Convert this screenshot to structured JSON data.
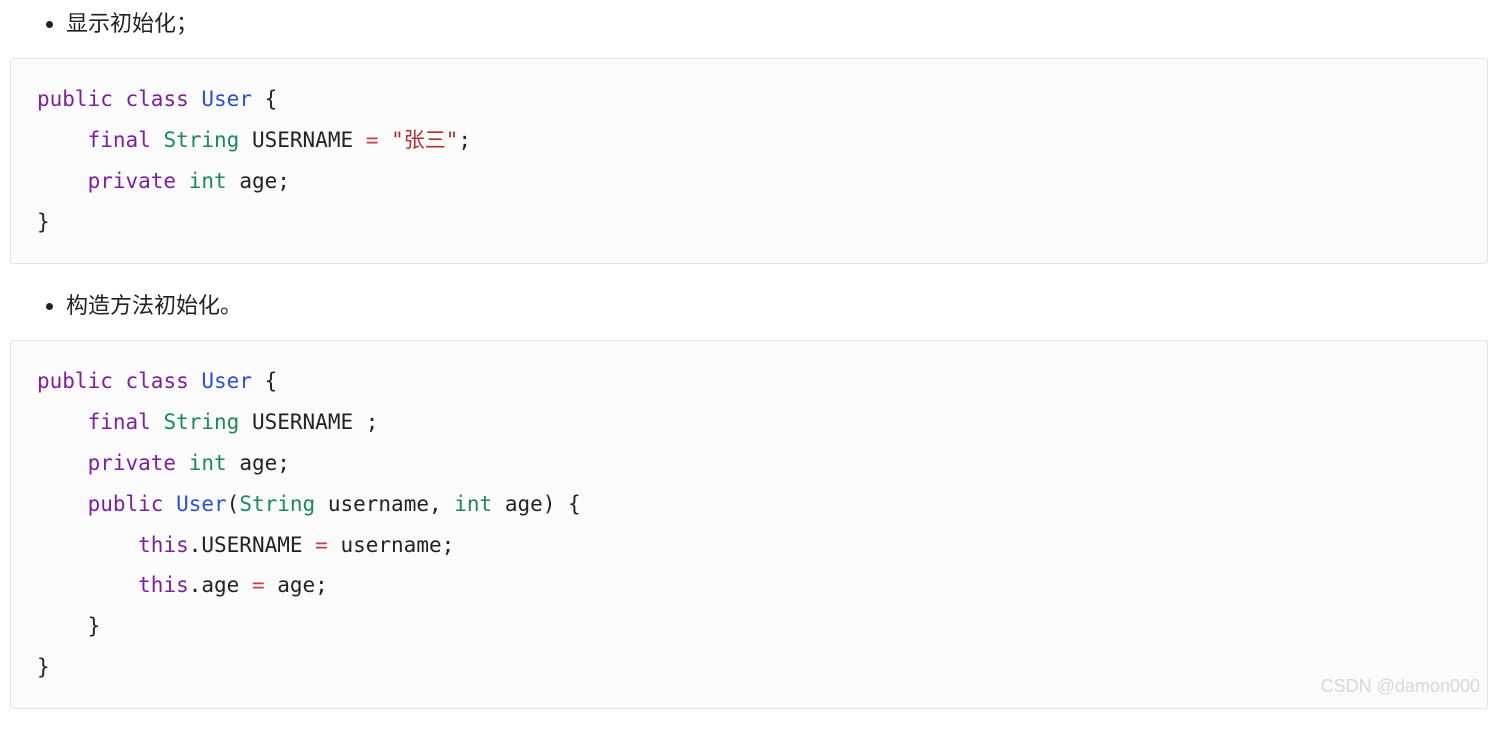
{
  "bullets": {
    "first": "显示初始化；",
    "second": "构造方法初始化。"
  },
  "code1": {
    "tokens": [
      {
        "t": "public",
        "c": "kw"
      },
      {
        "t": " "
      },
      {
        "t": "class",
        "c": "kw"
      },
      {
        "t": " "
      },
      {
        "t": "User",
        "c": "cls"
      },
      {
        "t": " {"
      },
      {
        "t": "\n    "
      },
      {
        "t": "final",
        "c": "kw"
      },
      {
        "t": " "
      },
      {
        "t": "String",
        "c": "type"
      },
      {
        "t": " USERNAME "
      },
      {
        "t": "=",
        "c": "op"
      },
      {
        "t": " "
      },
      {
        "t": "\"张三\"",
        "c": "str"
      },
      {
        "t": ";"
      },
      {
        "t": "\n    "
      },
      {
        "t": "private",
        "c": "kw"
      },
      {
        "t": " "
      },
      {
        "t": "int",
        "c": "type"
      },
      {
        "t": " age;"
      },
      {
        "t": "\n}"
      }
    ]
  },
  "code2": {
    "tokens": [
      {
        "t": "public",
        "c": "kw"
      },
      {
        "t": " "
      },
      {
        "t": "class",
        "c": "kw"
      },
      {
        "t": " "
      },
      {
        "t": "User",
        "c": "cls"
      },
      {
        "t": " {"
      },
      {
        "t": "\n    "
      },
      {
        "t": "final",
        "c": "kw"
      },
      {
        "t": " "
      },
      {
        "t": "String",
        "c": "type"
      },
      {
        "t": " USERNAME ;"
      },
      {
        "t": "\n    "
      },
      {
        "t": "private",
        "c": "kw"
      },
      {
        "t": " "
      },
      {
        "t": "int",
        "c": "type"
      },
      {
        "t": " age;"
      },
      {
        "t": "\n    "
      },
      {
        "t": "public",
        "c": "kw"
      },
      {
        "t": " "
      },
      {
        "t": "User",
        "c": "fn"
      },
      {
        "t": "("
      },
      {
        "t": "String",
        "c": "type"
      },
      {
        "t": " username, "
      },
      {
        "t": "int",
        "c": "type"
      },
      {
        "t": " age) {"
      },
      {
        "t": "\n        "
      },
      {
        "t": "this",
        "c": "kw"
      },
      {
        "t": ".USERNAME "
      },
      {
        "t": "=",
        "c": "op"
      },
      {
        "t": " username;"
      },
      {
        "t": "\n        "
      },
      {
        "t": "this",
        "c": "kw"
      },
      {
        "t": ".age "
      },
      {
        "t": "=",
        "c": "op"
      },
      {
        "t": " age;"
      },
      {
        "t": "\n    }"
      },
      {
        "t": "\n}"
      }
    ]
  },
  "watermark": "CSDN @damon000"
}
